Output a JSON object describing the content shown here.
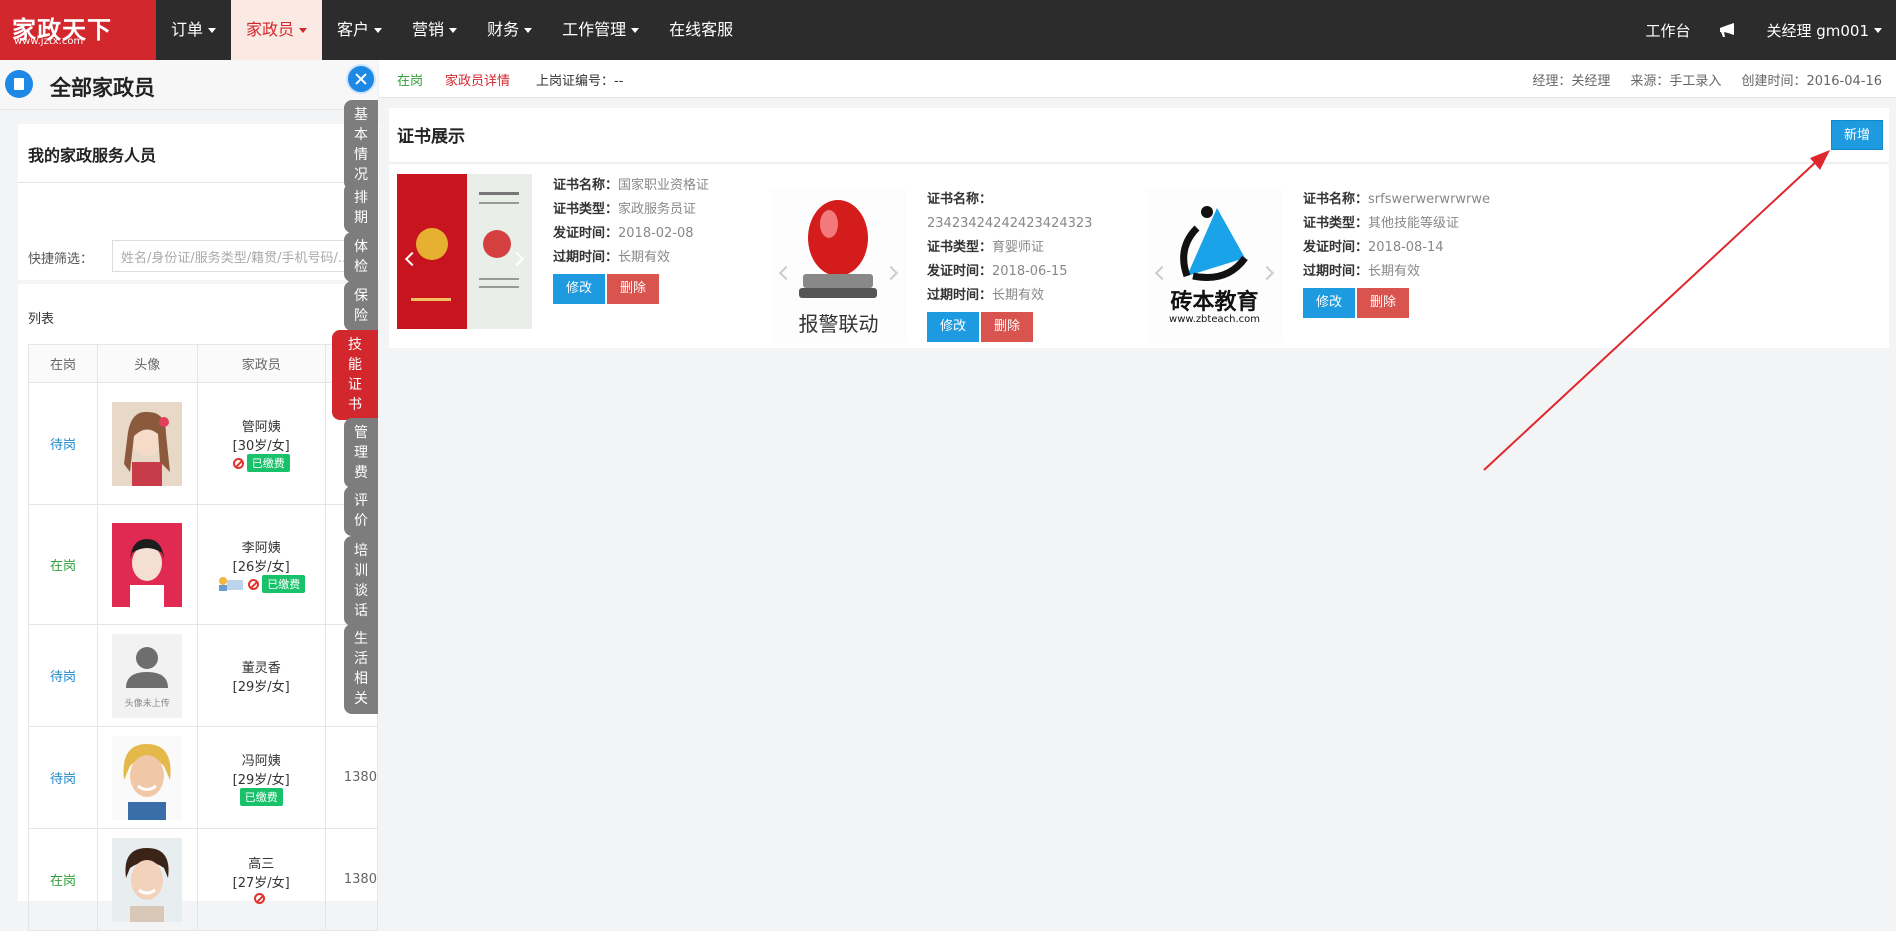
{
  "logo": {
    "big": "家政天下",
    "small": "www.jztx.com"
  },
  "nav": {
    "items": [
      {
        "label": "订单",
        "dropdown": true,
        "active": false
      },
      {
        "label": "家政员",
        "dropdown": true,
        "active": true
      },
      {
        "label": "客户",
        "dropdown": true,
        "active": false
      },
      {
        "label": "营销",
        "dropdown": true,
        "active": false
      },
      {
        "label": "财务",
        "dropdown": true,
        "active": false
      },
      {
        "label": "工作管理",
        "dropdown": true,
        "active": false
      },
      {
        "label": "在线客服",
        "dropdown": false,
        "active": false
      }
    ],
    "workbench": "工作台",
    "user": "关经理  gm001"
  },
  "left": {
    "title": "全部家政员",
    "subtitle": "我的家政服务人员",
    "quick_label": "快捷筛选：",
    "quick_placeholder": "姓名/身份证/服务类型/籍贯/手机号码/...",
    "list_label": "列表",
    "columns": [
      "在岗",
      "头像",
      "家政员"
    ],
    "rows": [
      {
        "status": "待岗",
        "name": "管阿姨",
        "age": "[30岁/女]",
        "badge": "已缴费",
        "phone": ""
      },
      {
        "status": "在岗",
        "name": "李阿姨",
        "age": "[26岁/女]",
        "badge": "已缴费",
        "phone": ""
      },
      {
        "status": "待岗",
        "name": "董灵香",
        "age": "[29岁/女]",
        "badge": "",
        "phone": "",
        "avatar_text": "头像未上传"
      },
      {
        "status": "待岗",
        "name": "冯阿姨",
        "age": "[29岁/女]",
        "badge": "已缴费",
        "phone": "1380"
      },
      {
        "status": "在岗",
        "name": "高三",
        "age": "[27岁/女]",
        "badge": "",
        "phone": "1380"
      }
    ]
  },
  "vtabs": [
    {
      "label": "基本情况"
    },
    {
      "label": "排期"
    },
    {
      "label": "体检"
    },
    {
      "label": "保险"
    },
    {
      "label": "技能证书",
      "active": true
    },
    {
      "label": "管理费"
    },
    {
      "label": "评价"
    },
    {
      "label": "培训谈话"
    },
    {
      "label": "生活相关"
    }
  ],
  "main": {
    "status": "在岗",
    "detail": "家政员详情",
    "cert_no": "上岗证编号：--",
    "manager": "经理：关经理",
    "source": "来源：手工录入",
    "created": "创建时间：2016-04-16",
    "section_title": "证书展示",
    "new_button": "新增",
    "labels": {
      "name": "证书名称：",
      "type": "证书类型：",
      "issue": "发证时间：",
      "expire": "过期时间："
    },
    "edit_button": "修改",
    "delete_button": "删除",
    "certs": [
      {
        "name": "国家职业资格证",
        "type": "家政服务员证",
        "issue": "2018-02-08",
        "expire": "长期有效",
        "image": "certificate-book"
      },
      {
        "name": "23423424242423424323",
        "type": "育婴师证",
        "issue": "2018-06-15",
        "expire": "长期有效",
        "image": "alarm-siren",
        "image_text": "报警联动"
      },
      {
        "name": "srfswerwerwrwrwe",
        "type": "其他技能等级证",
        "issue": "2018-08-14",
        "expire": "长期有效",
        "image": "zbteach-logo",
        "image_text": "砖本教育",
        "image_sub": "www.zbteach.com"
      }
    ]
  },
  "colors": {
    "brand_red": "#d2272d",
    "primary_blue": "#1e9be0",
    "danger": "#d9534f",
    "success": "#19c16a"
  }
}
